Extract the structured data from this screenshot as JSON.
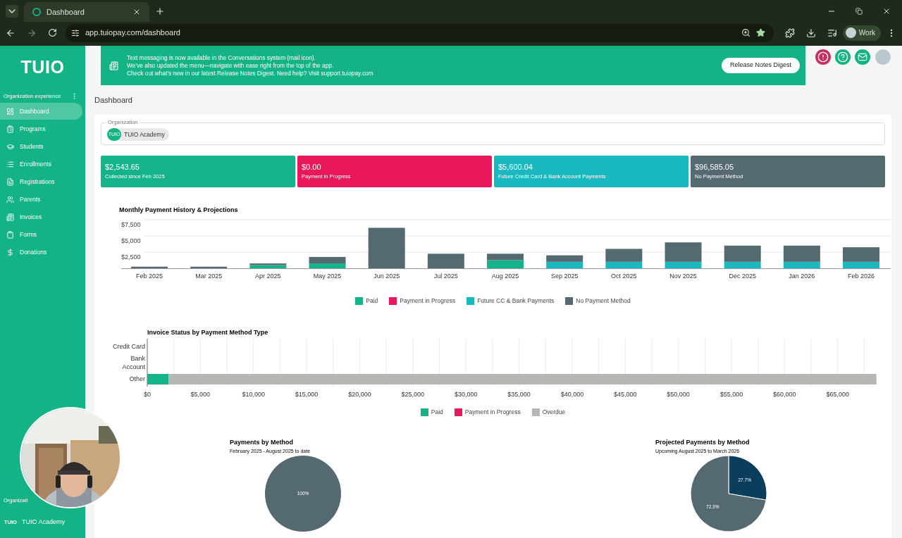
{
  "browser": {
    "tabs": [
      {
        "title": "Dashboard",
        "selected": true
      }
    ],
    "url": "app.tuiopay.com/dashboard",
    "profile": "Work"
  },
  "sidebar": {
    "logo": "TUIO",
    "section": "Organization experience",
    "items": [
      {
        "label": "Dashboard",
        "selected": true
      },
      {
        "label": "Programs",
        "selected": false
      },
      {
        "label": "Students",
        "selected": false
      },
      {
        "label": "Enrollments",
        "selected": false
      },
      {
        "label": "Registrations",
        "selected": false
      },
      {
        "label": "Parents",
        "selected": false
      },
      {
        "label": "Invoices",
        "selected": false
      },
      {
        "label": "Forms",
        "selected": false
      },
      {
        "label": "Donations",
        "selected": false
      }
    ],
    "footer_label": "Organizati",
    "org_logo": "TUIO",
    "org_name": "TUIO Academy"
  },
  "banner": {
    "lines": [
      "Text messaging is now available in the Conversations system (mail icon).",
      "We’ve also updated the menu—navigate with ease right from the top of the app.",
      "Check out what’s new in our latest Release Notes Digest. Need help? Visit support.tuiopay.com"
    ],
    "button": "Release Notes Digest"
  },
  "page_title": "Dashboard",
  "organization": {
    "label": "Organization",
    "chip_logo": "TUIO",
    "chip": "TUIO Academy"
  },
  "stats": [
    {
      "value": "$2,543.65",
      "label": "Collected since Feb 2025",
      "color": "#14b38a"
    },
    {
      "value": "$0.00",
      "label": "Payment in Progress",
      "color": "#e8185a"
    },
    {
      "value": "$5,600.04",
      "label": "Future Credit Card & Bank Account Payments",
      "color": "#19b9bf"
    },
    {
      "value": "$96,585.05",
      "label": "No Payment Method",
      "color": "#546a70"
    }
  ],
  "monthly": {
    "chart_data": {
      "type": "bar",
      "title": "Monthly Payment History & Projections",
      "stacked": true,
      "grid": true,
      "ylim": [
        0,
        7500
      ],
      "categories": [
        "Feb 2025",
        "Mar 2025",
        "Apr 2025",
        "May 2025",
        "Jun 2025",
        "Jul 2025",
        "Aug 2025",
        "Sep 2025",
        "Oct 2025",
        "Nov 2025",
        "Dec 2025",
        "Jan 2026",
        "Feb 2026"
      ],
      "yticks": [
        {
          "value": 2500,
          "label": "$2,500"
        },
        {
          "value": 5000,
          "label": "$5,000"
        },
        {
          "value": 7500,
          "label": "$7,500"
        }
      ],
      "series": [
        {
          "name": "Paid",
          "color": "#14b38a",
          "values": [
            0,
            0,
            500,
            750,
            0,
            0,
            1250,
            0,
            0,
            0,
            0,
            0,
            0
          ]
        },
        {
          "name": "Payment in Progress",
          "color": "#e8185a",
          "values": [
            0,
            0,
            0,
            0,
            0,
            0,
            0,
            0,
            0,
            0,
            0,
            0,
            0
          ]
        },
        {
          "name": "Future CC & Bank Payments",
          "color": "#19b9bf",
          "values": [
            0,
            0,
            0,
            0,
            0,
            0,
            0,
            1000,
            1000,
            1000,
            1000,
            1000,
            1000
          ]
        },
        {
          "name": "No Payment Method",
          "color": "#546a70",
          "values": [
            250,
            250,
            250,
            1000,
            6250,
            2250,
            1000,
            1000,
            2000,
            3000,
            2500,
            2500,
            2250
          ]
        }
      ]
    }
  },
  "invoice_status": {
    "chart_data": {
      "type": "bar",
      "title": "Invoice Status by Payment Method Type",
      "stacked": true,
      "orientation": "horizontal",
      "grid": true,
      "xlim": [
        0,
        69000
      ],
      "categories": [
        "Credit Card",
        "Bank Account",
        "Other"
      ],
      "xticks": [
        {
          "value": 0,
          "label": "$0"
        },
        {
          "value": 5000,
          "label": "$5,000"
        },
        {
          "value": 10000,
          "label": "$10,000"
        },
        {
          "value": 15000,
          "label": "$15,000"
        },
        {
          "value": 20000,
          "label": "$20,000"
        },
        {
          "value": 25000,
          "label": "$25,000"
        },
        {
          "value": 30000,
          "label": "$30,000"
        },
        {
          "value": 35000,
          "label": "$35,000"
        },
        {
          "value": 40000,
          "label": "$40,000"
        },
        {
          "value": 45000,
          "label": "$45,000"
        },
        {
          "value": 50000,
          "label": "$50,000"
        },
        {
          "value": 55000,
          "label": "$55,000"
        },
        {
          "value": 60000,
          "label": "$60,000"
        },
        {
          "value": 65000,
          "label": "$65,000"
        }
      ],
      "series": [
        {
          "name": "Paid",
          "color": "#14b38a",
          "values": [
            0,
            0,
            2000
          ]
        },
        {
          "name": "Payment in Progress",
          "color": "#e8185a",
          "values": [
            0,
            0,
            0
          ]
        },
        {
          "name": "Overdue",
          "color": "#b4b7b2",
          "values": [
            0,
            0,
            66650
          ]
        }
      ]
    }
  },
  "pies": [
    {
      "chart_data": {
        "type": "pie",
        "title": "Payments by Method",
        "subtitle": "February 2025 - August 2025 to date",
        "series": [
          {
            "values": [
              100
            ]
          }
        ],
        "colors": [
          "#546a70"
        ],
        "value_labels": [
          "100%"
        ]
      }
    },
    {
      "chart_data": {
        "type": "pie",
        "title": "Projected Payments by Method",
        "subtitle": "Upcoming August 2025 to March 2026",
        "series": [
          {
            "values": [
              27.7,
              72.3
            ]
          }
        ],
        "colors": [
          "#0b3d5c",
          "#546a70"
        ],
        "value_labels": [
          "27.7%",
          "72.3%"
        ]
      }
    }
  ]
}
